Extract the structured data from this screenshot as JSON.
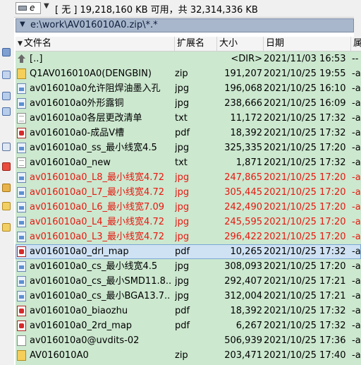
{
  "drivebar": {
    "drive_letter": "e",
    "info": "[ 无 ]  19,218,160 KB 可用，共 32,314,336 KB"
  },
  "pathbar": {
    "path": "e:\\work\\AV016010A0.zip\\*.*"
  },
  "columns": {
    "name": "文件名",
    "ext": "扩展名",
    "size": "大小",
    "date": "日期",
    "attr": "属"
  },
  "colors": {
    "list_bg": "#cce8cf",
    "red_text": "#e8170f",
    "path_bg": "#a9b7cc",
    "selected_bg": "#cfe2f3"
  },
  "files": [
    {
      "icon": "up-dir-icon",
      "name": "[..]",
      "ext": "",
      "size": "<DIR>",
      "date": "2021/11/03 16:53",
      "attr": "--",
      "red": false,
      "selected": false
    },
    {
      "icon": "zip-icon",
      "name": "Q1AV016010A0(DENGBIN)",
      "ext": "zip",
      "size": "191,207",
      "date": "2021/10/25 19:55",
      "attr": "-a",
      "red": false,
      "selected": false
    },
    {
      "icon": "jpg-icon",
      "name": "av016010a0允许阻焊油墨入孔",
      "ext": "jpg",
      "size": "196,068",
      "date": "2021/10/25 16:10",
      "attr": "-a",
      "red": false,
      "selected": false
    },
    {
      "icon": "jpg-icon",
      "name": "av016010a0外形露铜",
      "ext": "jpg",
      "size": "238,666",
      "date": "2021/10/25 16:09",
      "attr": "-a",
      "red": false,
      "selected": false
    },
    {
      "icon": "txt-icon",
      "name": "av016010a0各层更改清单",
      "ext": "txt",
      "size": "11,172",
      "date": "2021/10/25 17:32",
      "attr": "-a",
      "red": false,
      "selected": false
    },
    {
      "icon": "pdf-icon",
      "name": "av016010a0-成品V槽",
      "ext": "pdf",
      "size": "18,392",
      "date": "2021/10/25 17:32",
      "attr": "-a",
      "red": false,
      "selected": false
    },
    {
      "icon": "jpg-icon",
      "name": "av016010a0_ss_最小线宽4.5",
      "ext": "jpg",
      "size": "325,335",
      "date": "2021/10/25 17:20",
      "attr": "-a",
      "red": false,
      "selected": false
    },
    {
      "icon": "txt-icon",
      "name": "av016010a0_new",
      "ext": "txt",
      "size": "1,871",
      "date": "2021/10/25 17:32",
      "attr": "-a",
      "red": false,
      "selected": false
    },
    {
      "icon": "jpg-icon",
      "name": "av016010a0_L8_最小线宽4.72",
      "ext": "jpg",
      "size": "247,865",
      "date": "2021/10/25 17:20",
      "attr": "-a",
      "red": true,
      "selected": false
    },
    {
      "icon": "jpg-icon",
      "name": "av016010a0_L7_最小线宽4.72",
      "ext": "jpg",
      "size": "305,445",
      "date": "2021/10/25 17:20",
      "attr": "-a",
      "red": true,
      "selected": false
    },
    {
      "icon": "jpg-icon",
      "name": "av016010a0_L6_最小线宽7.09",
      "ext": "jpg",
      "size": "242,490",
      "date": "2021/10/25 17:20",
      "attr": "-a",
      "red": true,
      "selected": false
    },
    {
      "icon": "jpg-icon",
      "name": "av016010a0_L4_最小线宽4.72",
      "ext": "jpg",
      "size": "245,595",
      "date": "2021/10/25 17:20",
      "attr": "-a",
      "red": true,
      "selected": false
    },
    {
      "icon": "jpg-icon",
      "name": "av016010a0_L3_最小线宽4.72",
      "ext": "jpg",
      "size": "296,422",
      "date": "2021/10/25 17:20",
      "attr": "-a",
      "red": true,
      "selected": false
    },
    {
      "icon": "pdf-icon",
      "name": "av016010a0_drl_map",
      "ext": "pdf",
      "size": "10,265",
      "date": "2021/10/25 17:32",
      "attr": "-a",
      "red": false,
      "selected": true
    },
    {
      "icon": "jpg-icon",
      "name": "av016010a0_cs_最小线宽4.5",
      "ext": "jpg",
      "size": "308,093",
      "date": "2021/10/25 17:20",
      "attr": "-a",
      "red": false,
      "selected": false
    },
    {
      "icon": "jpg-icon",
      "name": "av016010a0_cs_最小SMD11.8..",
      "ext": "jpg",
      "size": "292,407",
      "date": "2021/10/25 17:21",
      "attr": "-a",
      "red": false,
      "selected": false
    },
    {
      "icon": "jpg-icon",
      "name": "av016010a0_cs_最小BGA13.7..",
      "ext": "jpg",
      "size": "312,004",
      "date": "2021/10/25 17:21",
      "attr": "-a",
      "red": false,
      "selected": false
    },
    {
      "icon": "pdf-icon",
      "name": "av016010a0_biaozhu",
      "ext": "pdf",
      "size": "18,392",
      "date": "2021/10/25 17:32",
      "attr": "-a",
      "red": false,
      "selected": false
    },
    {
      "icon": "pdf-icon",
      "name": "av016010a0_2rd_map",
      "ext": "pdf",
      "size": "6,267",
      "date": "2021/10/25 17:32",
      "attr": "-a",
      "red": false,
      "selected": false
    },
    {
      "icon": "file-icon",
      "name": "av016010a0@uvdits-02",
      "ext": "",
      "size": "506,939",
      "date": "2021/10/25 17:36",
      "attr": "-a",
      "red": false,
      "selected": false
    },
    {
      "icon": "zip-icon",
      "name": "AV016010A0",
      "ext": "zip",
      "size": "203,471",
      "date": "2021/10/25 17:40",
      "attr": "-a",
      "red": false,
      "selected": false
    }
  ]
}
